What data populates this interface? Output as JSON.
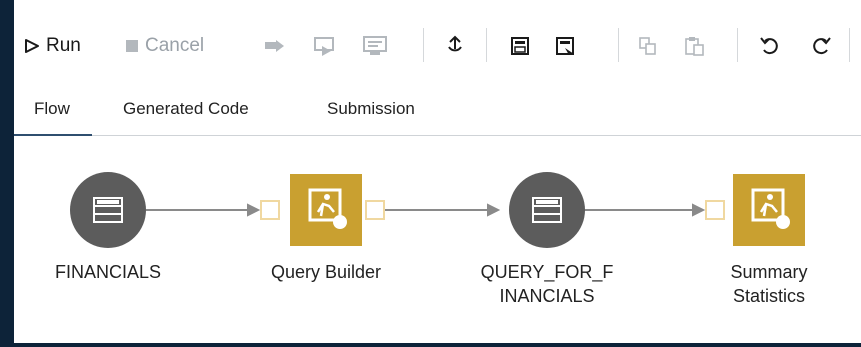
{
  "toolbar": {
    "run_label": "Run",
    "cancel_label": "Cancel"
  },
  "tabs": [
    {
      "label": "Flow",
      "active": true
    },
    {
      "label": "Generated Code",
      "active": false
    },
    {
      "label": "Submission",
      "active": false
    }
  ],
  "flow": {
    "nodes": [
      {
        "type": "data",
        "label_lines": [
          "FINANCIALS"
        ]
      },
      {
        "type": "step",
        "label_lines": [
          "Query Builder"
        ]
      },
      {
        "type": "data",
        "label_lines": [
          "QUERY_FOR_F",
          "INANCIALS"
        ]
      },
      {
        "type": "step",
        "label_lines": [
          "Summary",
          "Statistics"
        ]
      }
    ]
  },
  "colors": {
    "app_background": "#0d2339",
    "data_node": "#5c5c5c",
    "step_node": "#c9a030",
    "port_border": "#f0d8a0",
    "connector": "#8a8a8a"
  },
  "icons": {
    "run": "play-icon",
    "cancel": "stop-icon",
    "run_from_here": "run-from-node-icon",
    "run_to_here": "run-to-node-icon",
    "run_node": "run-node-icon",
    "upload": "upload-icon",
    "save": "save-icon",
    "save_as": "save-as-icon",
    "copy": "copy-icon",
    "paste": "paste-icon",
    "undo": "undo-icon",
    "redo": "redo-icon"
  }
}
